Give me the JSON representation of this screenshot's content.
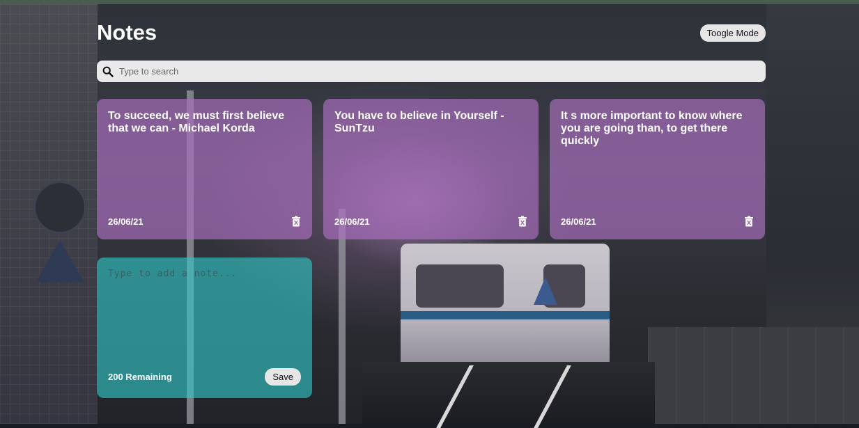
{
  "header": {
    "title": "Notes",
    "toggle_label": "Toogle Mode"
  },
  "search": {
    "placeholder": "Type to search",
    "value": "",
    "icon": "search-icon"
  },
  "notes": [
    {
      "text": "To succeed, we must first believe that we can - Michael Korda",
      "date": "26/06/21",
      "icon": "delete-icon"
    },
    {
      "text": "You have to believe in Yourself - SunTzu",
      "date": "26/06/21",
      "icon": "delete-icon"
    },
    {
      "text": "It s more important to know where you are going than, to get there quickly",
      "date": "26/06/21",
      "icon": "delete-icon"
    }
  ],
  "new_note": {
    "placeholder": "Type to add a note...",
    "value": "",
    "remaining_label": "200 Remaining",
    "save_label": "Save"
  },
  "colors": {
    "note_background": "#aa6ebe",
    "new_note_background": "#30c8c8",
    "button_background": "#e6e6e6",
    "search_background": "#e9e9e9"
  }
}
